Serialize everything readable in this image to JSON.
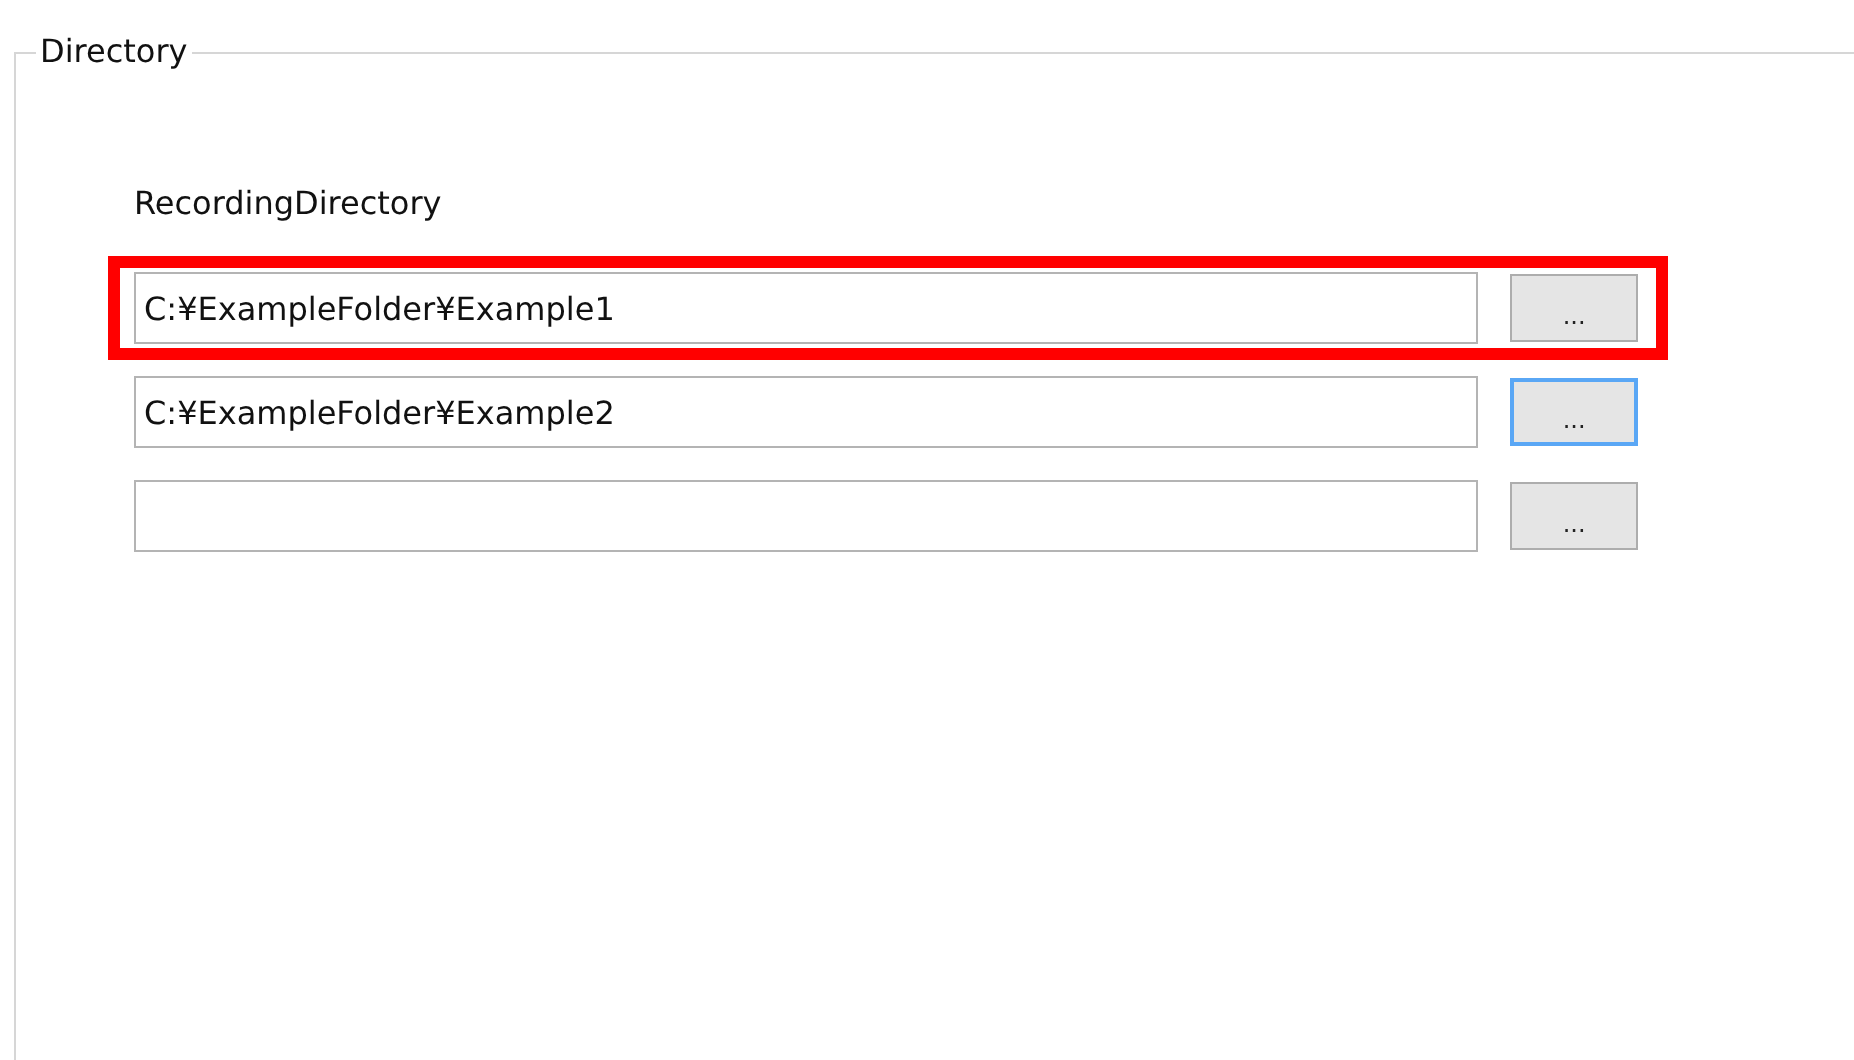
{
  "group": {
    "title": "Directory"
  },
  "label": "RecordingDirectory",
  "rows": [
    {
      "value": "C:¥ExampleFolder¥Example1",
      "highlighted": true,
      "button": "...",
      "focused": false
    },
    {
      "value": "C:¥ExampleFolder¥Example2",
      "highlighted": false,
      "button": "...",
      "focused": true
    },
    {
      "highlighted": false,
      "button": "...",
      "focused": false
    }
  ]
}
